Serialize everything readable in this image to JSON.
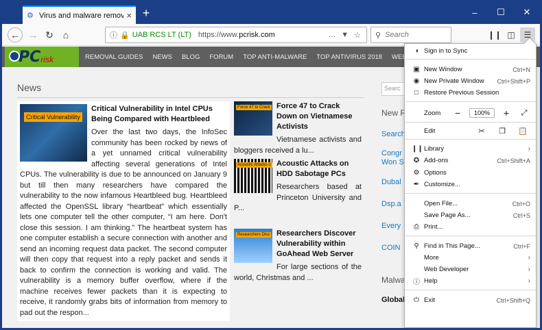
{
  "tab": {
    "title": "Virus and malware removal ins…",
    "close": "×",
    "new": "+"
  },
  "window": {
    "minimize": "–",
    "maximize": "☐",
    "close": "✕"
  },
  "nav": {
    "org": "UAB RCS LT (LT)",
    "url_prefix": "https://www.",
    "url_domain": "pcrisk.com",
    "search_placeholder": "Search"
  },
  "site": {
    "logo_pc": "PC",
    "logo_risk": "risk",
    "menu": [
      "REMOVAL GUIDES",
      "NEWS",
      "BLOG",
      "FORUM",
      "TOP ANTI-MALWARE",
      "TOP ANTIVIRUS 2018",
      "WEBSITE SCANNER"
    ]
  },
  "news": {
    "heading": "News",
    "main": {
      "thumb_label": "Critical Vulnerability",
      "title": "Critical Vulnerability in Intel CPUs Being Compared with Heartbleed",
      "text": "Over the last two days, the InfoSec community has been rocked by news of a yet unnamed critical vulnerability affecting several generations of Intel CPUs. The vulnerability is due to be announced on January 9 but till then many researchers have compared the vulnerability to the now infamous Heartbleed bug. Heartbleed affected the OpenSSL library “heartbeat” which essentially lets one computer tell the other computer, “I am here. Don't close this session. I am thinking.” The heartbeat system has one computer establish a secure connection with another and send an incoming request data packet. The second computer will then copy that request into a reply packet and sends it back to confirm the connection is working and valid. The vulnerability is a memory buffer overflow, where if the machine receives fewer packets than it is expecting to receive, it randomly grabs bits of information from memory to pad out the respon..."
    },
    "side": [
      {
        "thumb_label": "Force 47 to Crack",
        "title": "Force 47 to Crack Down on Vietnamese Activists",
        "text": "Vietnamese activists and bloggers received a lu..."
      },
      {
        "thumb_label": "Acoustic Attacks o",
        "title": "Acoustic Attacks on HDD Sabotage PCs",
        "text": "Researchers based at Princeton University and P..."
      },
      {
        "thumb_label": "Researchers Disc",
        "title": "Researchers Discover Vulnerability within GoAhead Web Server",
        "text": "For large sections of the world, Christmas and ..."
      }
    ]
  },
  "sidebar": {
    "search": "Searc",
    "heading": "New R",
    "links": [
      "Search",
      "Congr Won S",
      "Dubal",
      "Dsp.a",
      "Every",
      "COIN"
    ],
    "malware_heading": "Malwa",
    "global": "Global virus and spyware activity level"
  },
  "menu": {
    "sync": "Sign in to Sync",
    "new_window": "New Window",
    "new_window_sc": "Ctrl+N",
    "new_private": "New Private Window",
    "new_private_sc": "Ctrl+Shift+P",
    "restore": "Restore Previous Session",
    "zoom": "Zoom",
    "zoom_value": "100%",
    "edit": "Edit",
    "library": "Library",
    "addons": "Add-ons",
    "addons_sc": "Ctrl+Shift+A",
    "options": "Options",
    "customize": "Customize...",
    "open_file": "Open File...",
    "open_file_sc": "Ctrl+O",
    "save_page": "Save Page As...",
    "save_page_sc": "Ctrl+S",
    "print": "Print...",
    "find": "Find in This Page...",
    "find_sc": "Ctrl+F",
    "more": "More",
    "web_dev": "Web Developer",
    "help": "Help",
    "exit": "Exit",
    "exit_sc": "Ctrl+Shift+Q"
  }
}
